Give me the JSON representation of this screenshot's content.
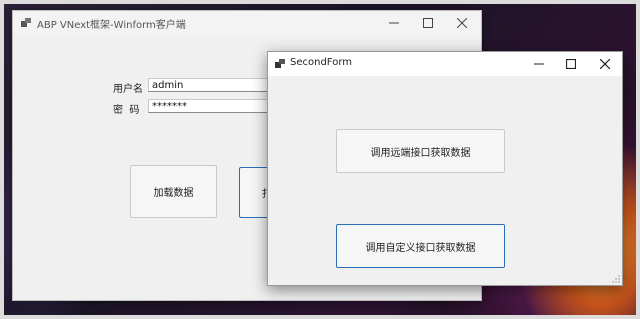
{
  "main_window": {
    "title": "ABP VNext框架-Winform客户端",
    "username_label": "用户名",
    "username_value": "admin",
    "password_label": "密  码",
    "password_value": "*******",
    "load_button": "加载数据",
    "partial_button": "打"
  },
  "second_window": {
    "title": "SecondForm",
    "remote_button": "调用远端接口获取数据",
    "custom_button": "调用自定义接口获取数据"
  },
  "icons": [
    "app-icon",
    "minimize-icon",
    "maximize-icon",
    "close-icon",
    "resize-grip-icon"
  ]
}
